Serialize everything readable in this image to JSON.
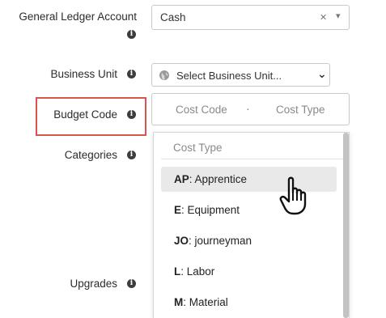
{
  "form": {
    "gl_account": {
      "label": "General Ledger Account",
      "value": "Cash",
      "clear_glyph": "✕",
      "caret_glyph": "▾"
    },
    "business_unit": {
      "label": "Business Unit",
      "placeholder": "Select Business Unit...",
      "caret_glyph": "⌄"
    },
    "budget_code": {
      "label": "Budget Code",
      "cost_code_placeholder": "Cost Code",
      "separator": "·",
      "cost_type_placeholder": "Cost Type"
    },
    "categories": {
      "label": "Categories"
    },
    "upgrades": {
      "label": "Upgrades"
    },
    "info_glyph": "i"
  },
  "dropdown": {
    "header": "Cost Type",
    "items": [
      {
        "code": "AP",
        "name": ": Apprentice",
        "active": true
      },
      {
        "code": "E",
        "name": ": Equipment",
        "active": false
      },
      {
        "code": "JO",
        "name": ": journeyman",
        "active": false
      },
      {
        "code": "L",
        "name": ": Labor",
        "active": false
      },
      {
        "code": "M",
        "name": ": Material",
        "active": false
      }
    ]
  },
  "colors": {
    "highlight": "#d9534f",
    "active_item": "#e9e9e9",
    "scrollbar": "#c3c3c3"
  },
  "icons": {
    "info": "info-icon",
    "globe": "globe-icon",
    "cursor": "hand-pointer-icon"
  }
}
